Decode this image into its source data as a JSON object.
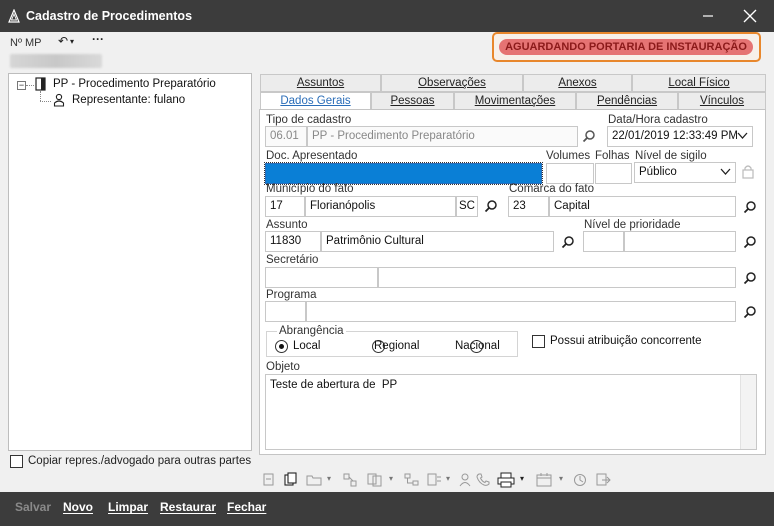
{
  "window": {
    "title": "Cadastro de Procedimentos"
  },
  "header": {
    "nmp_label": "Nº MP",
    "status": "AGUARDANDO PORTARIA DE INSTAURAÇÃO"
  },
  "tree": {
    "root": "PP - Procedimento Preparatório",
    "child": "Representante: fulano",
    "copy_checkbox_label": "Copiar repres./advogado para outras partes"
  },
  "tabs": {
    "row1": [
      "Assuntos",
      "Observações",
      "Anexos",
      "Local Físico"
    ],
    "row2": [
      "Dados Gerais",
      "Pessoas",
      "Movimentações",
      "Pendências",
      "Vínculos"
    ]
  },
  "form": {
    "tipo_cadastro_label": "Tipo de cadastro",
    "tipo_cadastro_code": "06.01",
    "tipo_cadastro_value": "PP - Procedimento Preparatório",
    "data_hora_label": "Data/Hora cadastro",
    "data_hora_value": "22/01/2019 12:33:49 PM",
    "doc_label": "Doc. Apresentado",
    "volumes_label": "Volumes",
    "folhas_label": "Folhas",
    "sigilo_label": "Nível de sigilo",
    "sigilo_value": "Público",
    "municipio_label": "Município do fato",
    "municipio_code": "17",
    "municipio_value": "Florianópolis",
    "municipio_uf": "SC",
    "comarca_label": "Comarca do fato",
    "comarca_code": "23",
    "comarca_value": "Capital",
    "assunto_label": "Assunto",
    "assunto_code": "11830",
    "assunto_value": "Patrimônio Cultural",
    "prioridade_label": "Nível de prioridade",
    "secretario_label": "Secretário",
    "programa_label": "Programa",
    "abrangencia_label": "Abrangência",
    "abrangencia_options": [
      "Local",
      "Regional",
      "Nacional"
    ],
    "abrangencia_selected": "Local",
    "atribuicao_label": "Possui atribuição concorrente",
    "objeto_label": "Objeto",
    "objeto_value": "Teste de abertura de  PP"
  },
  "footer": {
    "buttons": [
      "Salvar",
      "Novo",
      "Limpar",
      "Restaurar",
      "Fechar"
    ]
  },
  "colors": {
    "accent": "#2a6db8",
    "status_bg": "#e57373",
    "status_border": "#e8872c",
    "titlebar": "#3c3c3c"
  }
}
